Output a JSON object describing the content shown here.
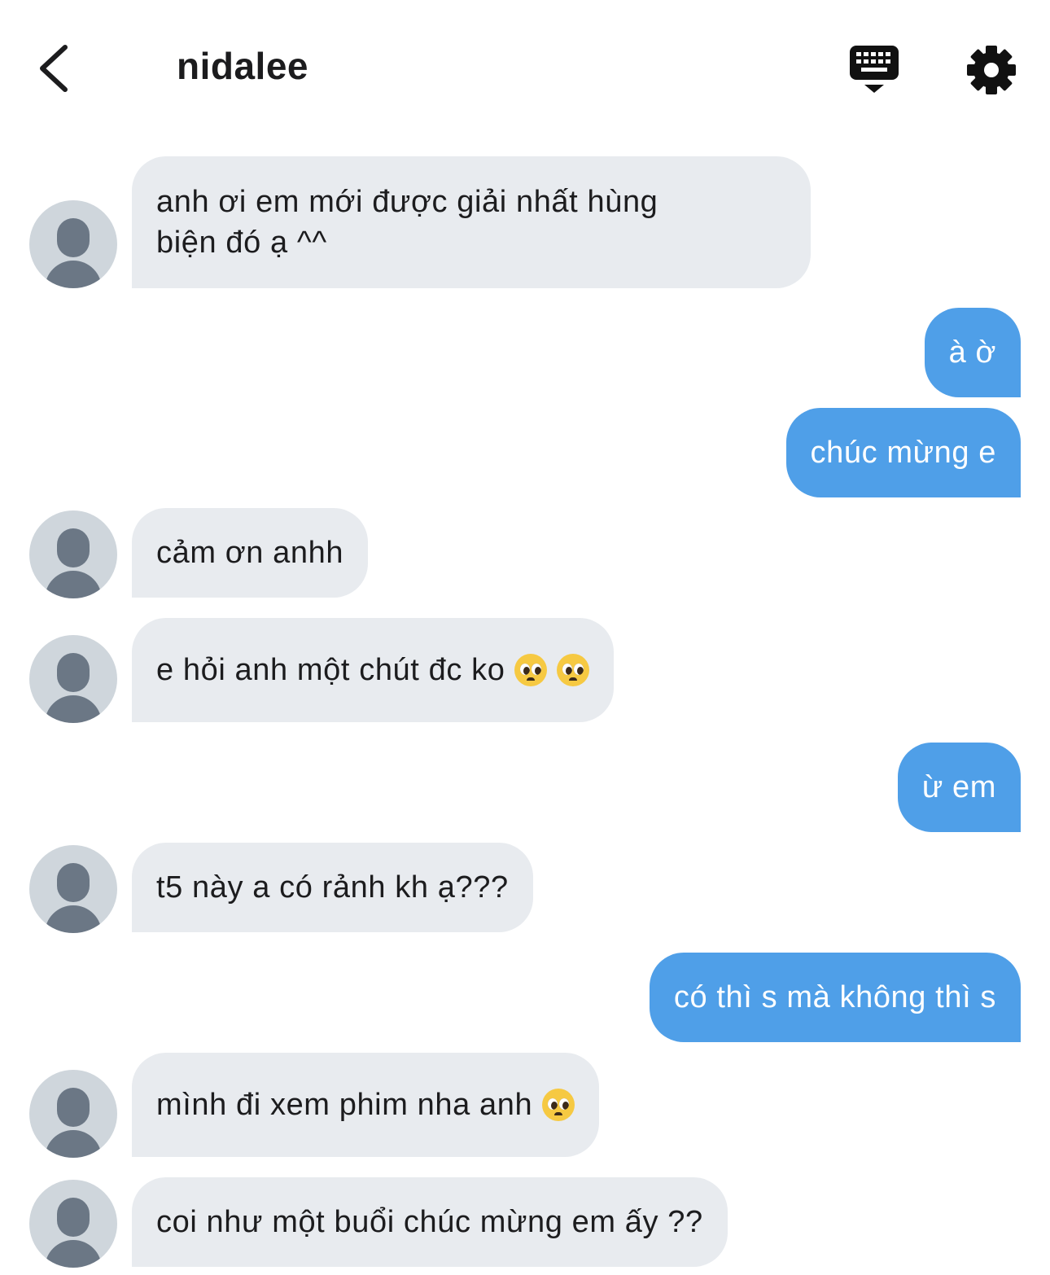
{
  "header": {
    "title": "nidalee",
    "back_icon": "chevron-left-icon",
    "keyboard_icon": "keyboard-icon",
    "settings_icon": "gear-icon"
  },
  "colors": {
    "incoming_bubble": "#e8ebef",
    "outgoing_bubble": "#4f9fe8",
    "avatar_bg": "#cfd6dc",
    "avatar_fg": "#6b7785"
  },
  "messages": [
    {
      "direction": "in",
      "text": "anh ơi em mới được giải nhất hùng biện đó ạ ^^"
    },
    {
      "direction": "out",
      "text": "à ờ"
    },
    {
      "direction": "out",
      "text": "chúc mừng e"
    },
    {
      "direction": "in",
      "text": "cảm ơn anhh"
    },
    {
      "direction": "in",
      "text": "e hỏi anh một chút đc ko",
      "emoji": [
        "pleading-face-emoji",
        "pleading-face-emoji"
      ]
    },
    {
      "direction": "out",
      "text": "ừ em"
    },
    {
      "direction": "in",
      "text": "t5 này a có rảnh kh ạ???"
    },
    {
      "direction": "out",
      "text": "có thì s mà không thì s"
    },
    {
      "direction": "in",
      "text": "mình đi xem phim nha anh",
      "emoji": [
        "pleading-face-emoji"
      ]
    },
    {
      "direction": "in",
      "text": "coi như một buổi chúc mừng em ấy ??"
    }
  ]
}
